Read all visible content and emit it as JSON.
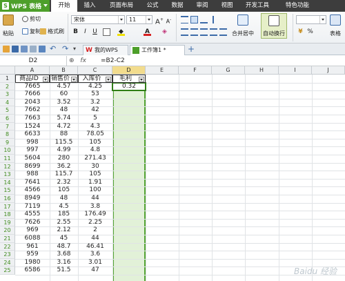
{
  "menubar": {
    "app_name": "WPS 表格",
    "app_logo": "S",
    "items": [
      "开始",
      "插入",
      "页面布局",
      "公式",
      "数据",
      "审阅",
      "视图",
      "开发工具",
      "特色功能"
    ],
    "active_index": 0
  },
  "ribbon": {
    "paste": "粘贴",
    "cut": "剪切",
    "copy": "复制",
    "format_painter": "格式刷",
    "font_name": "宋体",
    "font_size": "11",
    "merge_center": "合并居中",
    "wrap_text": "自动换行",
    "percent": "%",
    "table_style": "表格"
  },
  "tabs": {
    "wps_tab": "我的WPS",
    "workbook_tab": "工作簿1 *"
  },
  "formula_bar": {
    "cell_ref": "D2",
    "fx": "fx",
    "formula": "=B2-C2"
  },
  "sheet": {
    "columns": [
      "A",
      "B",
      "C",
      "D",
      "E",
      "F",
      "G",
      "H",
      "I",
      "J"
    ],
    "selected_column": "D",
    "selected_cell": "D2",
    "header_row": [
      "商品ID",
      "销售价",
      "入库价",
      "毛利"
    ],
    "rows": [
      [
        "7665",
        "4.57",
        "4.25",
        "0.32"
      ],
      [
        "7666",
        "60",
        "53",
        ""
      ],
      [
        "2043",
        "3.52",
        "3.2",
        ""
      ],
      [
        "7662",
        "48",
        "42",
        ""
      ],
      [
        "7663",
        "5.74",
        "5",
        ""
      ],
      [
        "1524",
        "4.72",
        "4.3",
        ""
      ],
      [
        "6633",
        "88",
        "78.05",
        ""
      ],
      [
        "998",
        "115.5",
        "105",
        ""
      ],
      [
        "997",
        "4.99",
        "4.8",
        ""
      ],
      [
        "5604",
        "280",
        "271.43",
        ""
      ],
      [
        "8699",
        "36.2",
        "30",
        ""
      ],
      [
        "988",
        "115.7",
        "105",
        ""
      ],
      [
        "7641",
        "2.32",
        "1.91",
        ""
      ],
      [
        "4566",
        "105",
        "100",
        ""
      ],
      [
        "8949",
        "48",
        "44",
        ""
      ],
      [
        "7119",
        "4.5",
        "3.8",
        ""
      ],
      [
        "4555",
        "185",
        "176.49",
        ""
      ],
      [
        "7626",
        "2.55",
        "2.25",
        ""
      ],
      [
        "969",
        "2.12",
        "2",
        ""
      ],
      [
        "6088",
        "45",
        "44",
        ""
      ],
      [
        "961",
        "48.7",
        "46.41",
        ""
      ],
      [
        "959",
        "3.68",
        "3.6",
        ""
      ],
      [
        "1980",
        "3.16",
        "3.01",
        ""
      ],
      [
        "6586",
        "51.5",
        "47",
        ""
      ]
    ]
  },
  "watermark": "Baidu 经验",
  "colors": {
    "app_green": "#4d9f2a",
    "selection_fill": "#e2f1d8",
    "selection_border": "#55a535",
    "selected_header": "#f2dc8d"
  }
}
